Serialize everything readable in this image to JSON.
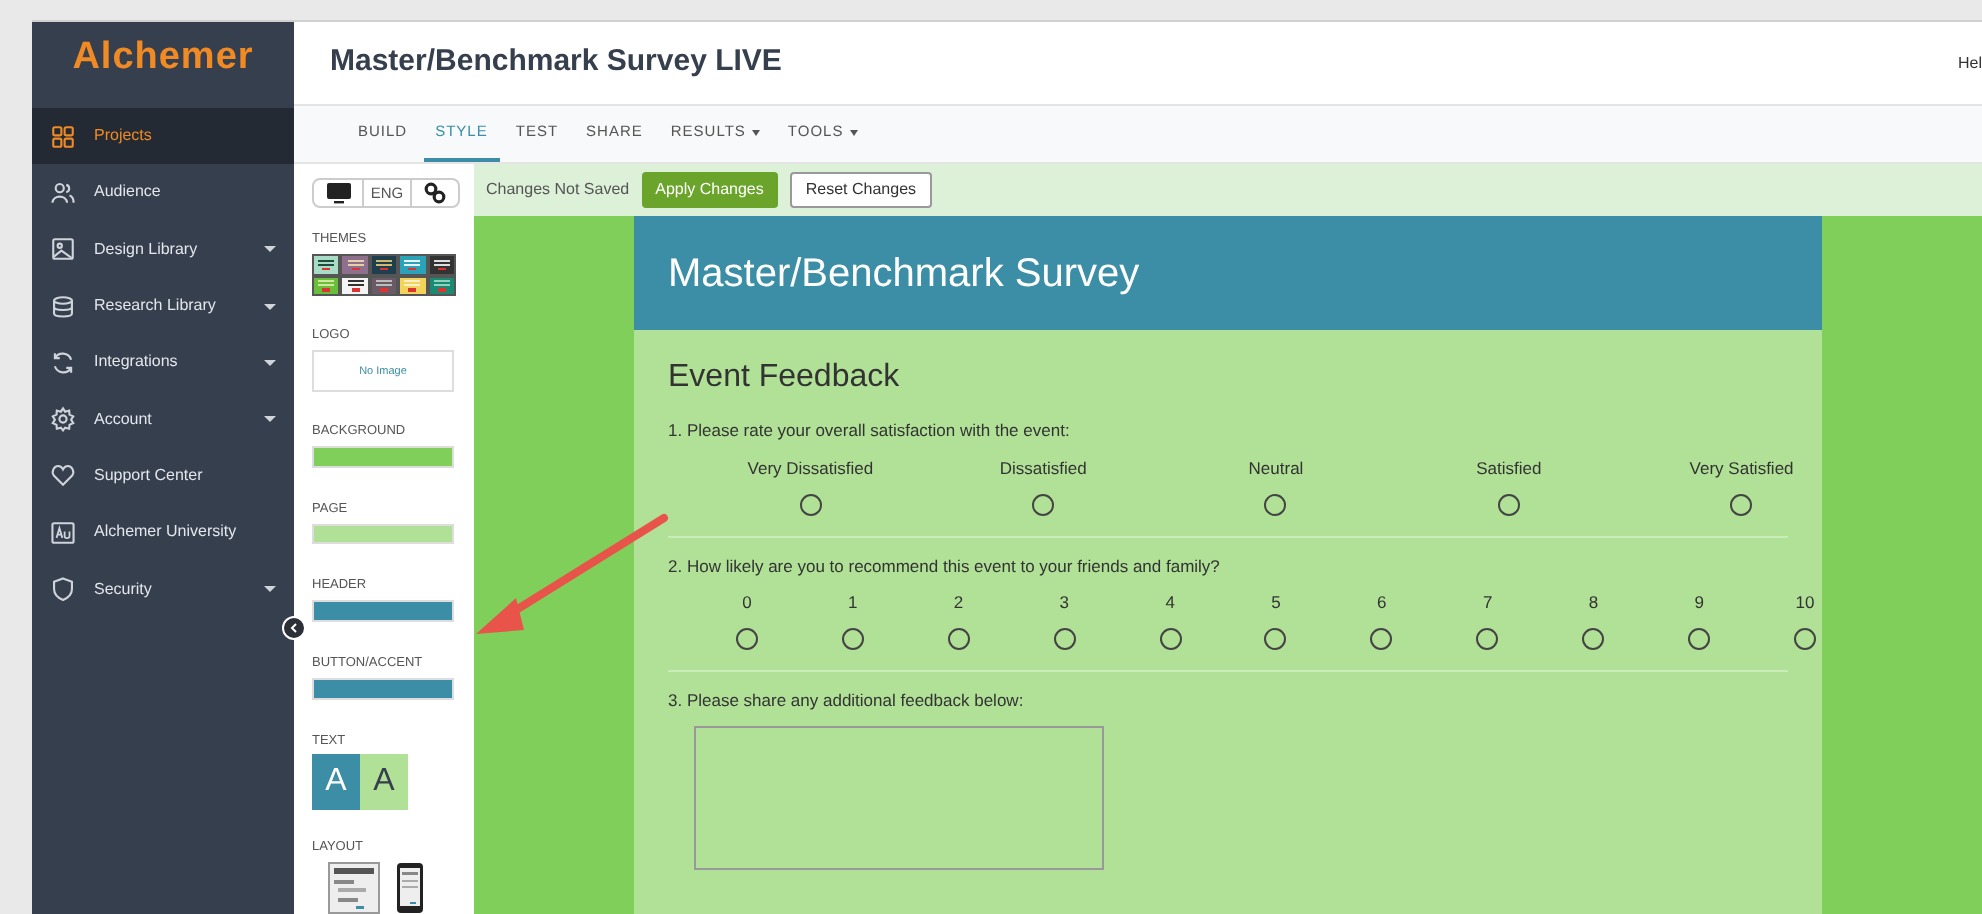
{
  "sidebar": {
    "logo": "Alchemer",
    "items": [
      {
        "label": "Projects",
        "selected": true,
        "caret": false
      },
      {
        "label": "Audience",
        "selected": false,
        "caret": false
      },
      {
        "label": "Design Library",
        "selected": false,
        "caret": true
      },
      {
        "label": "Research Library",
        "selected": false,
        "caret": true
      },
      {
        "label": "Integrations",
        "selected": false,
        "caret": true
      },
      {
        "label": "Account",
        "selected": false,
        "caret": true
      },
      {
        "label": "Support Center",
        "selected": false,
        "caret": false
      },
      {
        "label": "Alchemer University",
        "selected": false,
        "caret": false
      },
      {
        "label": "Security",
        "selected": false,
        "caret": true
      }
    ]
  },
  "header": {
    "title": "Master/Benchmark Survey LIVE",
    "help": "Hel"
  },
  "tabs": [
    {
      "label": "BUILD",
      "selected": false,
      "caret": false
    },
    {
      "label": "STYLE",
      "selected": true,
      "caret": false
    },
    {
      "label": "TEST",
      "selected": false,
      "caret": false
    },
    {
      "label": "SHARE",
      "selected": false,
      "caret": false
    },
    {
      "label": "RESULTS",
      "selected": false,
      "caret": true
    },
    {
      "label": "TOOLS",
      "selected": false,
      "caret": true
    }
  ],
  "style_panel": {
    "language": "ENG",
    "sections": [
      {
        "kind": "themes",
        "label": "THEMES"
      },
      {
        "kind": "logo",
        "label": "LOGO",
        "value": "No Image"
      },
      {
        "kind": "color",
        "label": "BACKGROUND",
        "color": "#80cf5a"
      },
      {
        "kind": "color",
        "label": "PAGE",
        "color": "#b0e196"
      },
      {
        "kind": "color",
        "label": "HEADER",
        "color": "#3b8ea5"
      },
      {
        "kind": "color",
        "label": "BUTTON/ACCENT",
        "color": "#3b8ea5"
      },
      {
        "kind": "text",
        "label": "TEXT",
        "samples": [
          "A",
          "A"
        ]
      },
      {
        "kind": "layout",
        "label": "LAYOUT"
      }
    ]
  },
  "save_bar": {
    "status": "Changes Not Saved",
    "buttons": [
      "Apply Changes",
      "Reset Changes"
    ]
  },
  "survey": {
    "title": "Master/Benchmark Survey",
    "page_title": "Event Feedback",
    "questions": [
      {
        "kind": "radio",
        "text": "1. Please rate your overall satisfaction with the event:",
        "options": [
          {
            "label": "Very Dissatisfied",
            "selected": false
          },
          {
            "label": "Dissatisfied",
            "selected": false
          },
          {
            "label": "Neutral",
            "selected": false
          },
          {
            "label": "Satisfied",
            "selected": false
          },
          {
            "label": "Very Satisfied",
            "selected": false
          }
        ]
      },
      {
        "kind": "radio",
        "text": "2. How likely are you to recommend this event to your friends and family?",
        "options": [
          {
            "label": "0",
            "selected": false
          },
          {
            "label": "1",
            "selected": false
          },
          {
            "label": "2",
            "selected": false
          },
          {
            "label": "3",
            "selected": false
          },
          {
            "label": "4",
            "selected": false
          },
          {
            "label": "5",
            "selected": false
          },
          {
            "label": "6",
            "selected": false
          },
          {
            "label": "7",
            "selected": false
          },
          {
            "label": "8",
            "selected": false
          },
          {
            "label": "9",
            "selected": false
          },
          {
            "label": "10",
            "selected": false
          }
        ]
      },
      {
        "kind": "textarea",
        "text": "3. Please share any additional feedback below:"
      }
    ]
  }
}
